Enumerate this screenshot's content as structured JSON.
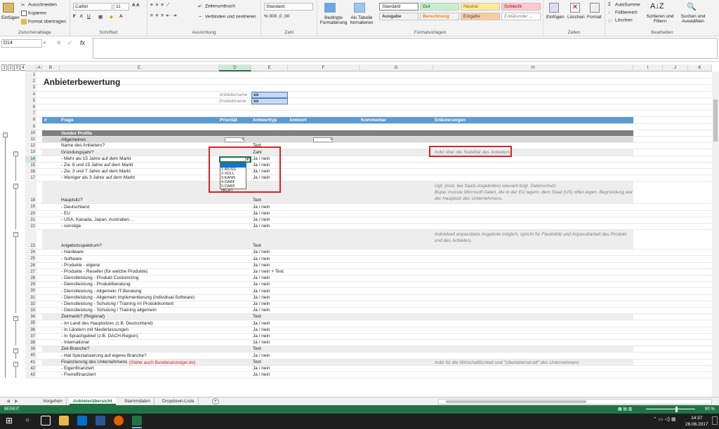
{
  "ribbon": {
    "clipboard": {
      "paste": "Einfügen",
      "cut": "Ausschneiden",
      "copy": "Kopieren",
      "format_painter": "Format übertragen",
      "label": "Zwischenablage"
    },
    "font": {
      "name": "Calibri",
      "size": "11",
      "label": "Schriftart"
    },
    "alignment": {
      "wrap": "Zeilenumbruch",
      "merge": "Verbinden und zentrieren",
      "label": "Ausrichtung"
    },
    "number": {
      "format": "Standard",
      "label": "Zahl"
    },
    "styles": {
      "cond": "Bedingte Formatierung",
      "table": "Als Tabelle formatieren",
      "standard": "Standard",
      "gut": "Gut",
      "neutral": "Neutral",
      "schlecht": "Schlecht",
      "ausgabe": "Ausgabe",
      "berechnung": "Berechnung",
      "eingabe": "Eingabe",
      "erklaerend": "Erklärender ...",
      "label": "Formatvorlagen"
    },
    "cells": {
      "insert": "Einfügen",
      "delete": "Löschen",
      "format": "Format",
      "label": "Zellen"
    },
    "editing": {
      "autosum": "AutoSumme",
      "fill": "Füllbereich",
      "clear": "Löschen",
      "sort": "Sortieren und Filtern",
      "find": "Suchen und Auswählen",
      "label": "Bearbeiten"
    }
  },
  "formula_bar": {
    "name_box": "D14",
    "fx": "fx"
  },
  "outline_levels": [
    "1",
    "2",
    "3",
    "4"
  ],
  "columns": [
    "A",
    "B",
    "C",
    "D",
    "E",
    "F",
    "G",
    "H",
    "I",
    "J",
    "K"
  ],
  "sheet": {
    "title": "Anbieterbewertung",
    "anbietername_label": "Anbietername",
    "anbietername_value": "xx",
    "produktname_label": "Produktname",
    "produktname_value": "xx",
    "header": {
      "nr": "#",
      "frage": "Frage",
      "prio": "Priorität",
      "typ": "Antworttyp",
      "antwort": "Antwort",
      "kommentar": "Kommentar",
      "erl": "Erläuterungen"
    },
    "vendor": "Vendor Profile",
    "allgemeines": "Allgemeines",
    "dropdown_options": [
      "",
      "1-MUSS",
      "2-SOLL",
      "3-KANN",
      "4-DARF",
      "5-DARF NICHT"
    ],
    "notes": {
      "r13": "Indiz über die Stabilität des Anbieters",
      "r18a": "Ggf. (insb. bei SaaS-Angeboten) relevant bzgl. Datenschutz.",
      "r18b": "Bspw. musste Microsoft Daten, die in der EU lagern, dem Staat (US) offen legen. Begründung war",
      "r18c": "der Hauptsitz des Unternehmens.",
      "r23a": "Individuell anpassbare Angebote möglich, spricht für Flexibilität und Anpassbarkeit des Produkt",
      "r23b": "und des Anbieters",
      "r41": "Indiz für die Wirtschaftlichkeit und \"Überlebenskraft\" des Unternehmens"
    },
    "rows": [
      {
        "n": "1",
        "q": "",
        "t": ""
      },
      {
        "n": "2",
        "q": "",
        "t": ""
      },
      {
        "n": "3",
        "q": "",
        "t": ""
      },
      {
        "n": "4",
        "q": "",
        "t": ""
      },
      {
        "n": "5",
        "q": "",
        "t": ""
      },
      {
        "n": "6",
        "q": "",
        "t": ""
      },
      {
        "n": "7",
        "q": "",
        "t": ""
      },
      {
        "n": "8",
        "q": "",
        "t": ""
      },
      {
        "n": "9",
        "q": "",
        "t": ""
      },
      {
        "n": "10",
        "q": "",
        "t": ""
      },
      {
        "n": "11",
        "q": "",
        "t": ""
      },
      {
        "n": "12",
        "q": "Name des Anbieters?",
        "t": "Text"
      },
      {
        "n": "13",
        "q": "Gründungsjahr?",
        "t": "Zahl"
      },
      {
        "n": "14",
        "q": "- Mehr als 15 Jahre auf dem Markt",
        "t": "Ja / nein"
      },
      {
        "n": "15",
        "q": "- Zw. 8 und 15 Jahre auf dem Markt",
        "t": "Ja / nein"
      },
      {
        "n": "16",
        "q": "- Zw. 3 und 7 Jahre auf dem Markt",
        "t": "Ja / nein"
      },
      {
        "n": "17",
        "q": "- Weniger als 3 Jahre auf dem Markt",
        "t": "Ja / nein"
      },
      {
        "n": "18",
        "q": "Hauptsitz?",
        "t": "Text"
      },
      {
        "n": "19",
        "q": "- Deutschland",
        "t": "Ja / nein"
      },
      {
        "n": "20",
        "q": "- EU",
        "t": "Ja / nein"
      },
      {
        "n": "21",
        "q": "- USA, Kanada, Japan, Australien, ..",
        "t": "Ja / nein"
      },
      {
        "n": "22",
        "q": "- sonstige",
        "t": "Ja / nein"
      },
      {
        "n": "23",
        "q": "Angebotsspektrum?",
        "t": "Text"
      },
      {
        "n": "24",
        "q": "- Hardware",
        "t": "Ja / nein"
      },
      {
        "n": "25",
        "q": "- Software",
        "t": "Ja / nein"
      },
      {
        "n": "26",
        "q": "- Produkte - eigene",
        "t": "Ja / nein"
      },
      {
        "n": "27",
        "q": "- Produkte - Reseller (für welche Produkte)",
        "t": "Ja / nein + Text"
      },
      {
        "n": "28",
        "q": "- Dienstleistung - Produkt Customizing",
        "t": "Ja / nein"
      },
      {
        "n": "29",
        "q": "- Dienstleistung - Produktberatung",
        "t": "Ja / nein"
      },
      {
        "n": "30",
        "q": "- Dienstleistung - Allgemein IT-Beratung",
        "t": "Ja / nein"
      },
      {
        "n": "31",
        "q": "- Dienstleistung - Allgemein Implementierung (individual-Software)",
        "t": "Ja / nein"
      },
      {
        "n": "32",
        "q": "- Dienstleistung - Schulung / Training im Produktkontext",
        "t": "Ja / nein"
      },
      {
        "n": "33",
        "q": "- Dienstleistung - Schulung / Training allgemein",
        "t": "Ja / nein"
      },
      {
        "n": "34",
        "q": "Zielmarkt? (Regional)",
        "t": "Text"
      },
      {
        "n": "35",
        "q": "- Im Land des Hauptsitzes (z.B. Deutschland)",
        "t": "Ja / nein"
      },
      {
        "n": "36",
        "q": "- In Ländern mit Niederlassungen",
        "t": "Ja / nein"
      },
      {
        "n": "37",
        "q": "- In Sprachgebiet (z.B. DACH-Region)",
        "t": "Ja / nein"
      },
      {
        "n": "38",
        "q": "- International",
        "t": "Ja / nein"
      },
      {
        "n": "39",
        "q": "Ziel-Branche?",
        "t": "Text"
      },
      {
        "n": "40",
        "q": "- Hat Spezialisierung auf eigene Branche?",
        "t": "Ja / nein"
      },
      {
        "n": "41",
        "q": "Finanzierung des Unternehmens",
        "t": "Text"
      },
      {
        "n": "42",
        "q": "- Eigenfinanziert",
        "t": "Ja / nein"
      },
      {
        "n": "43",
        "q": "- Fremdfinanziert",
        "t": "Ja / nein"
      }
    ],
    "link41": "(Siehe auch Bundesanzeiger.de)"
  },
  "tabs": {
    "t1": "Vorgehen",
    "t2": "Anbieterübersicht",
    "t3": "Stammdaten",
    "t4": "Dropdown-Liste",
    "add": "+"
  },
  "status": {
    "ready": "BEREIT",
    "zoom": "90 %"
  },
  "clock": {
    "time": "14:37",
    "date": "26.06.2017"
  }
}
